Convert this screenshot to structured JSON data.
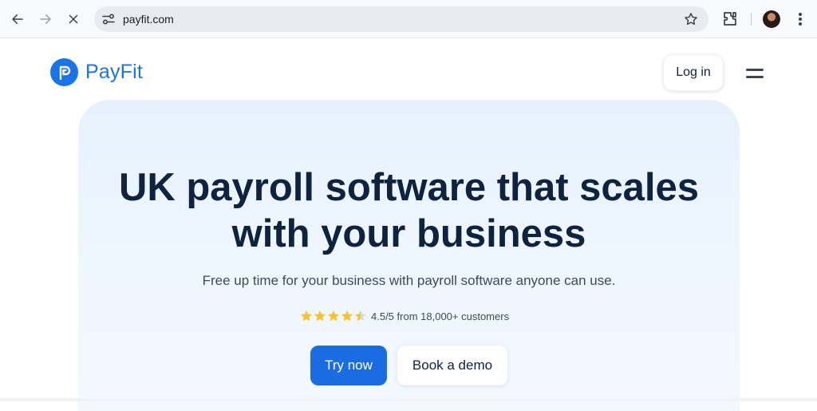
{
  "browser": {
    "url": "payfit.com",
    "icons": [
      "back-arrow-icon",
      "forward-arrow-icon",
      "stop-loading-icon",
      "site-settings-icon",
      "bookmark-star-icon",
      "extensions-icon",
      "profile-avatar",
      "more-menu-icon"
    ]
  },
  "header": {
    "logo_text": "PayFit",
    "login_label": "Log in"
  },
  "hero": {
    "title_line1": "UK payroll software that scales",
    "title_line2": "with your business",
    "subtitle": "Free up time for your business with payroll software anyone can use.",
    "rating": {
      "value": 4.5,
      "max": 5,
      "text": "4.5/5 from 18,000+ customers"
    },
    "primary_cta": "Try now",
    "secondary_cta": "Book a demo"
  },
  "colors": {
    "brand_blue": "#1a73e8",
    "cta_blue": "#1a6ce3",
    "heading_navy": "#0e2340",
    "star_gold": "#f6c32b",
    "hero_bg": "#e6f1fd"
  }
}
